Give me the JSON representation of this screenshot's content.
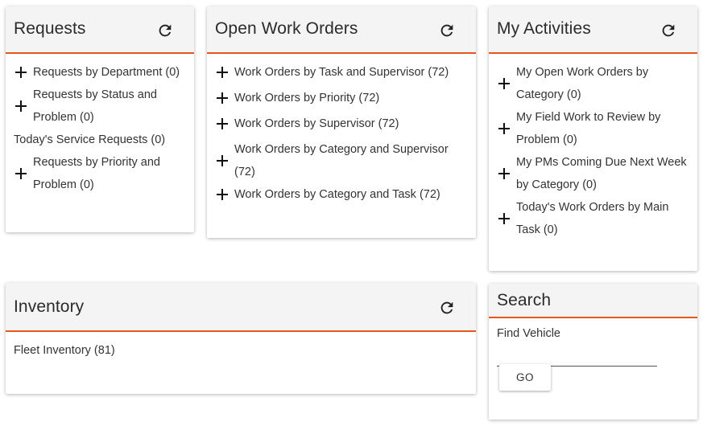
{
  "requests": {
    "title": "Requests",
    "refresh_icon": "refresh-icon",
    "items": [
      {
        "label": "Requests by Department (0)",
        "expandable": true
      },
      {
        "label": "Requests by Status and Problem (0)",
        "expandable": true
      },
      {
        "label": "Today's Service Requests (0)",
        "expandable": false
      },
      {
        "label": "Requests by Priority and Problem (0)",
        "expandable": true
      }
    ]
  },
  "open_work_orders": {
    "title": "Open Work Orders",
    "refresh_icon": "refresh-icon",
    "items": [
      {
        "label": "Work Orders by Task and Supervisor (72)",
        "expandable": true
      },
      {
        "label": "Work Orders by Priority (72)",
        "expandable": true
      },
      {
        "label": "Work Orders by Supervisor (72)",
        "expandable": true
      },
      {
        "label": "Work Orders by Category and Supervisor (72)",
        "expandable": true
      },
      {
        "label": "Work Orders by Category and Task (72)",
        "expandable": true
      }
    ]
  },
  "my_activities": {
    "title": "My Activities",
    "refresh_icon": "refresh-icon",
    "items": [
      {
        "label": "My Open Work Orders by Category (0)",
        "expandable": true
      },
      {
        "label": "My Field Work to Review by Problem (0)",
        "expandable": true
      },
      {
        "label": "My PMs Coming Due Next Week by Category (0)",
        "expandable": true
      },
      {
        "label": "Today's Work Orders by Main Task (0)",
        "expandable": true
      }
    ]
  },
  "inventory": {
    "title": "Inventory",
    "refresh_icon": "refresh-icon",
    "items": [
      {
        "label": "Fleet Inventory (81)",
        "expandable": false
      }
    ]
  },
  "search": {
    "title": "Search",
    "label": "Find Vehicle",
    "input_value": "",
    "go_label": "GO"
  },
  "colors": {
    "accent": "#e8561b",
    "header_bg": "#f4f4f4"
  }
}
